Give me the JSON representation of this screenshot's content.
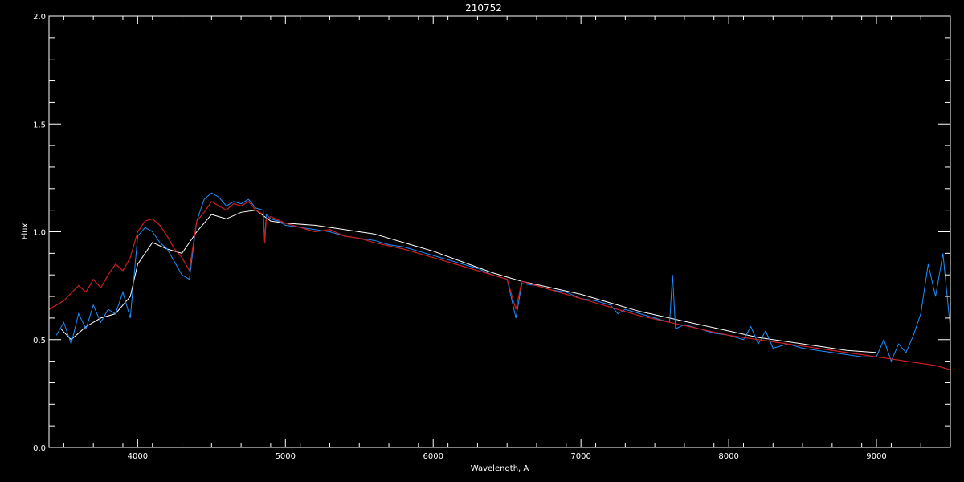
{
  "chart_data": {
    "type": "line",
    "title": "210752",
    "xlabel": "Wavelength, A",
    "ylabel": "Flux",
    "xlim": [
      3400,
      9500
    ],
    "ylim": [
      0.0,
      2.0
    ],
    "x_ticks": [
      4000,
      5000,
      6000,
      7000,
      8000,
      9000
    ],
    "x_tick_labels": [
      "4000",
      "5000",
      "6000",
      "7000",
      "8000",
      "9000"
    ],
    "y_ticks": [
      0.0,
      0.5,
      1.0,
      1.5,
      2.0
    ],
    "y_tick_labels": [
      "0.0",
      "0.5",
      "1.0",
      "1.5",
      "2.0"
    ],
    "grid": false,
    "colors": {
      "background": "#000000",
      "axes": "#ffffff",
      "observed_white": "#ffffff",
      "observed_blue": "#1e8fff",
      "model_red": "#cc1f1f"
    },
    "series": [
      {
        "key": "model",
        "color": "#cc1f1f",
        "x": [
          3400,
          3500,
          3600,
          3650,
          3700,
          3750,
          3800,
          3850,
          3900,
          3950,
          4000,
          4050,
          4100,
          4150,
          4200,
          4250,
          4300,
          4350,
          4400,
          4450,
          4500,
          4550,
          4600,
          4650,
          4700,
          4750,
          4800,
          4850,
          4860,
          4870,
          4900,
          5000,
          5100,
          5200,
          5300,
          5400,
          5500,
          5600,
          5800,
          6000,
          6200,
          6400,
          6500,
          6560,
          6600,
          6700,
          6800,
          7000,
          7200,
          7400,
          7600,
          7800,
          8000,
          8200,
          8400,
          8600,
          8800,
          9000,
          9200,
          9400,
          9500
        ],
        "y": [
          0.64,
          0.68,
          0.75,
          0.72,
          0.78,
          0.74,
          0.8,
          0.85,
          0.82,
          0.88,
          1.0,
          1.05,
          1.06,
          1.03,
          0.98,
          0.92,
          0.88,
          0.82,
          1.05,
          1.09,
          1.14,
          1.12,
          1.1,
          1.13,
          1.12,
          1.14,
          1.1,
          1.08,
          0.95,
          1.06,
          1.07,
          1.04,
          1.02,
          1.0,
          1.01,
          0.98,
          0.97,
          0.95,
          0.92,
          0.88,
          0.84,
          0.8,
          0.78,
          0.64,
          0.77,
          0.75,
          0.73,
          0.69,
          0.65,
          0.61,
          0.58,
          0.55,
          0.52,
          0.5,
          0.48,
          0.46,
          0.44,
          0.42,
          0.4,
          0.38,
          0.36
        ]
      },
      {
        "key": "observed_white",
        "color": "#ffffff",
        "x": [
          3480,
          3550,
          3650,
          3750,
          3850,
          3950,
          4000,
          4100,
          4200,
          4300,
          4400,
          4500,
          4600,
          4700,
          4800,
          4900,
          5000,
          5200,
          5400,
          5600,
          5800,
          6000,
          6200,
          6400,
          6600,
          6800,
          7000,
          7200,
          7400,
          7600,
          7800,
          8000,
          8200,
          8400,
          8600,
          8800,
          9000
        ],
        "y": [
          0.55,
          0.5,
          0.56,
          0.6,
          0.62,
          0.7,
          0.85,
          0.95,
          0.92,
          0.9,
          1.0,
          1.08,
          1.06,
          1.09,
          1.1,
          1.05,
          1.04,
          1.03,
          1.01,
          0.99,
          0.95,
          0.91,
          0.86,
          0.81,
          0.77,
          0.74,
          0.71,
          0.67,
          0.63,
          0.6,
          0.57,
          0.54,
          0.51,
          0.49,
          0.47,
          0.45,
          0.44
        ]
      },
      {
        "key": "observed_blue",
        "color": "#1e8fff",
        "x": [
          3450,
          3500,
          3550,
          3600,
          3650,
          3700,
          3750,
          3800,
          3850,
          3900,
          3950,
          4000,
          4050,
          4100,
          4150,
          4200,
          4250,
          4300,
          4350,
          4400,
          4450,
          4500,
          4550,
          4600,
          4650,
          4700,
          4750,
          4800,
          4850,
          4860,
          4870,
          4900,
          4950,
          5000,
          5100,
          5200,
          5300,
          5400,
          5500,
          5600,
          5700,
          5800,
          5900,
          6000,
          6100,
          6200,
          6300,
          6400,
          6500,
          6560,
          6600,
          6700,
          6800,
          6900,
          7000,
          7100,
          7200,
          7250,
          7300,
          7400,
          7500,
          7600,
          7620,
          7640,
          7700,
          7800,
          7900,
          8000,
          8100,
          8150,
          8200,
          8250,
          8300,
          8400,
          8500,
          8600,
          8700,
          8800,
          8900,
          9000,
          9050,
          9100,
          9150,
          9200,
          9250,
          9300,
          9350,
          9400,
          9450,
          9500
        ],
        "y": [
          0.52,
          0.58,
          0.48,
          0.62,
          0.55,
          0.66,
          0.58,
          0.64,
          0.62,
          0.72,
          0.6,
          0.98,
          1.02,
          1.0,
          0.95,
          0.92,
          0.86,
          0.8,
          0.78,
          1.05,
          1.15,
          1.18,
          1.16,
          1.12,
          1.14,
          1.13,
          1.15,
          1.11,
          1.1,
          0.95,
          1.08,
          1.06,
          1.05,
          1.03,
          1.02,
          1.01,
          1.0,
          0.98,
          0.97,
          0.96,
          0.94,
          0.93,
          0.91,
          0.89,
          0.87,
          0.85,
          0.83,
          0.8,
          0.78,
          0.6,
          0.76,
          0.75,
          0.73,
          0.72,
          0.69,
          0.68,
          0.66,
          0.62,
          0.64,
          0.62,
          0.6,
          0.58,
          0.8,
          0.55,
          0.57,
          0.55,
          0.53,
          0.52,
          0.5,
          0.56,
          0.48,
          0.54,
          0.46,
          0.48,
          0.46,
          0.45,
          0.44,
          0.43,
          0.42,
          0.42,
          0.5,
          0.4,
          0.48,
          0.44,
          0.52,
          0.62,
          0.85,
          0.7,
          0.9,
          0.55
        ]
      }
    ]
  }
}
